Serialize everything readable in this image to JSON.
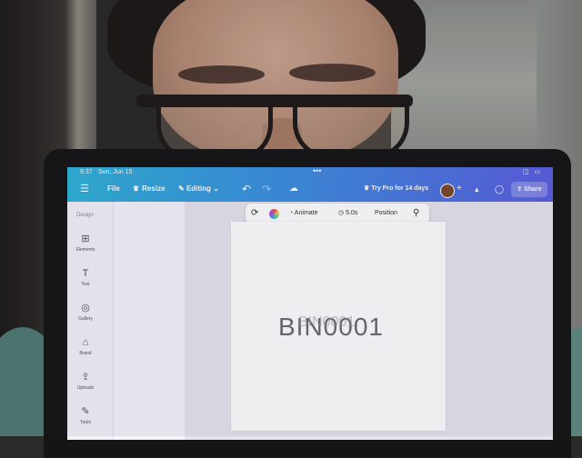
{
  "status": {
    "time": "9:37",
    "date": "Sun, Jun 15",
    "dots": "•••",
    "icons": "◫ ▭"
  },
  "toolbar": {
    "menu_icon": "☰",
    "file": "File",
    "resize": "Resize",
    "editing": "Editing",
    "undo_icon": "↶",
    "redo_icon": "↷",
    "cloud_icon": "☁",
    "try_pro": "Try Pro for 14 days",
    "plus_icon": "+",
    "chart_icon": "▴",
    "comment_icon": "◯",
    "share": "Share"
  },
  "side": {
    "title": "Design",
    "items": [
      {
        "icon": "⊞",
        "label": "Elements"
      },
      {
        "icon": "T",
        "label": "Text"
      },
      {
        "icon": "◎",
        "label": "Gallery"
      },
      {
        "icon": "⌂",
        "label": "Brand"
      },
      {
        "icon": "⇪",
        "label": "Uploads"
      },
      {
        "icon": "✎",
        "label": "Tools"
      }
    ]
  },
  "context_toolbar": {
    "refresh_icon": "⟳",
    "animate": "Animate",
    "duration": "5.0s",
    "position": "Position",
    "paint_icon": "⚲"
  },
  "canvas": {
    "text": "BIN0001",
    "ghost_text": "BIN0001"
  },
  "colors": {
    "topbar_start": "#2fb3d8",
    "topbar_end": "#5b5fe0",
    "canvas_bg": "#ffffff"
  }
}
